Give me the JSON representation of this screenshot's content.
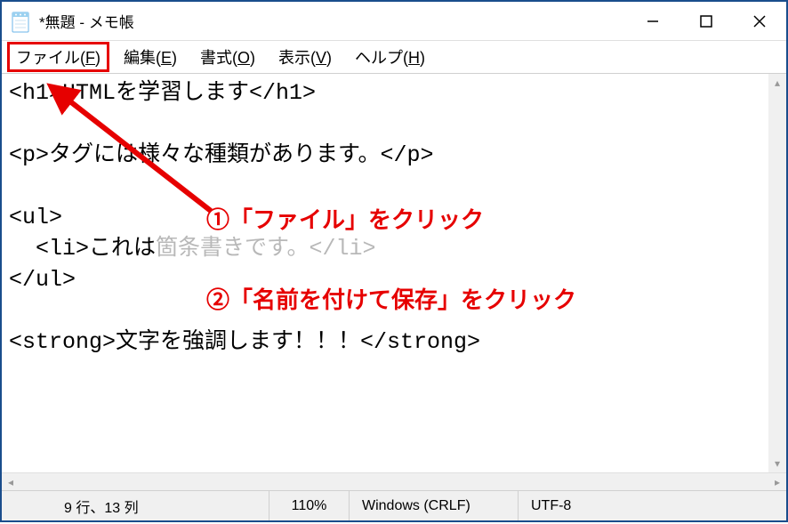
{
  "window": {
    "title": "*無題 - メモ帳"
  },
  "menu": {
    "file": "ファイル(F)",
    "edit": "編集(E)",
    "format": "書式(O)",
    "view": "表示(V)",
    "help": "ヘルプ(H)"
  },
  "editor": {
    "line1": "<h1>HTMLを学習します</h1>",
    "line2": "",
    "line3": "<p>タグには様々な種類があります。</p>",
    "line4": "",
    "line5": "<ul>",
    "line6a": "  <li>これは",
    "line6b": "箇条書きです。</li>",
    "line7": "</ul>",
    "line8": "",
    "line9": "<strong>文字を強調します！！！</strong>"
  },
  "status": {
    "pos": "9 行、13 列",
    "zoom": "110%",
    "eol": "Windows (CRLF)",
    "encoding": "UTF-8"
  },
  "annotations": {
    "step1": "①「ファイル」をクリック",
    "step2": "②「名前を付けて保存」をクリック"
  }
}
